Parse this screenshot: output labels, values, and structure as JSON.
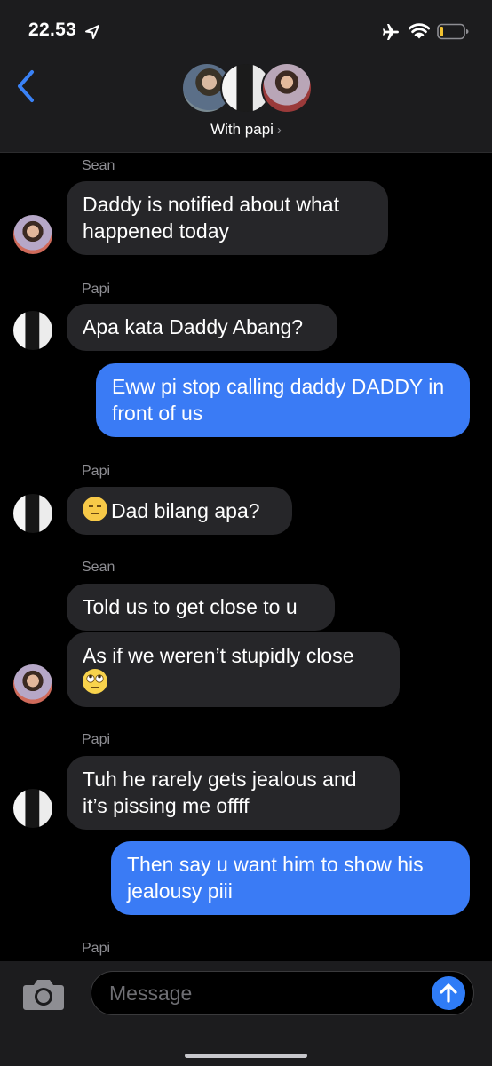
{
  "status_bar": {
    "time": "22.53"
  },
  "header": {
    "group_name": "With papi",
    "chevron": "›"
  },
  "messages": [
    {
      "sender": "Sean"
    },
    {
      "text": "Daddy is notified about what happened today"
    },
    {
      "sender": "Papi"
    },
    {
      "text": "Apa kata Daddy Abang?"
    },
    {
      "text": "Eww pi stop calling daddy DADDY in front of us"
    },
    {
      "sender": "Papi"
    },
    {
      "text": "Dad bilang apa?",
      "emoji": "expressionless-face"
    },
    {
      "sender": "Sean"
    },
    {
      "text": "Told us to get close to u"
    },
    {
      "text": "As if we weren’t stupidly close",
      "emoji": "eye-roll-face"
    },
    {
      "sender": "Papi"
    },
    {
      "text": "Tuh he rarely gets jealous and it’s pissing me offff"
    },
    {
      "text": "Then say u want him to show his jealousy piii"
    },
    {
      "sender": "Papi"
    }
  ],
  "input": {
    "placeholder": "Message"
  },
  "colors": {
    "incoming_bubble": "#262629",
    "outgoing_bubble": "#3a7bf5",
    "accent": "#2f7cf6"
  }
}
